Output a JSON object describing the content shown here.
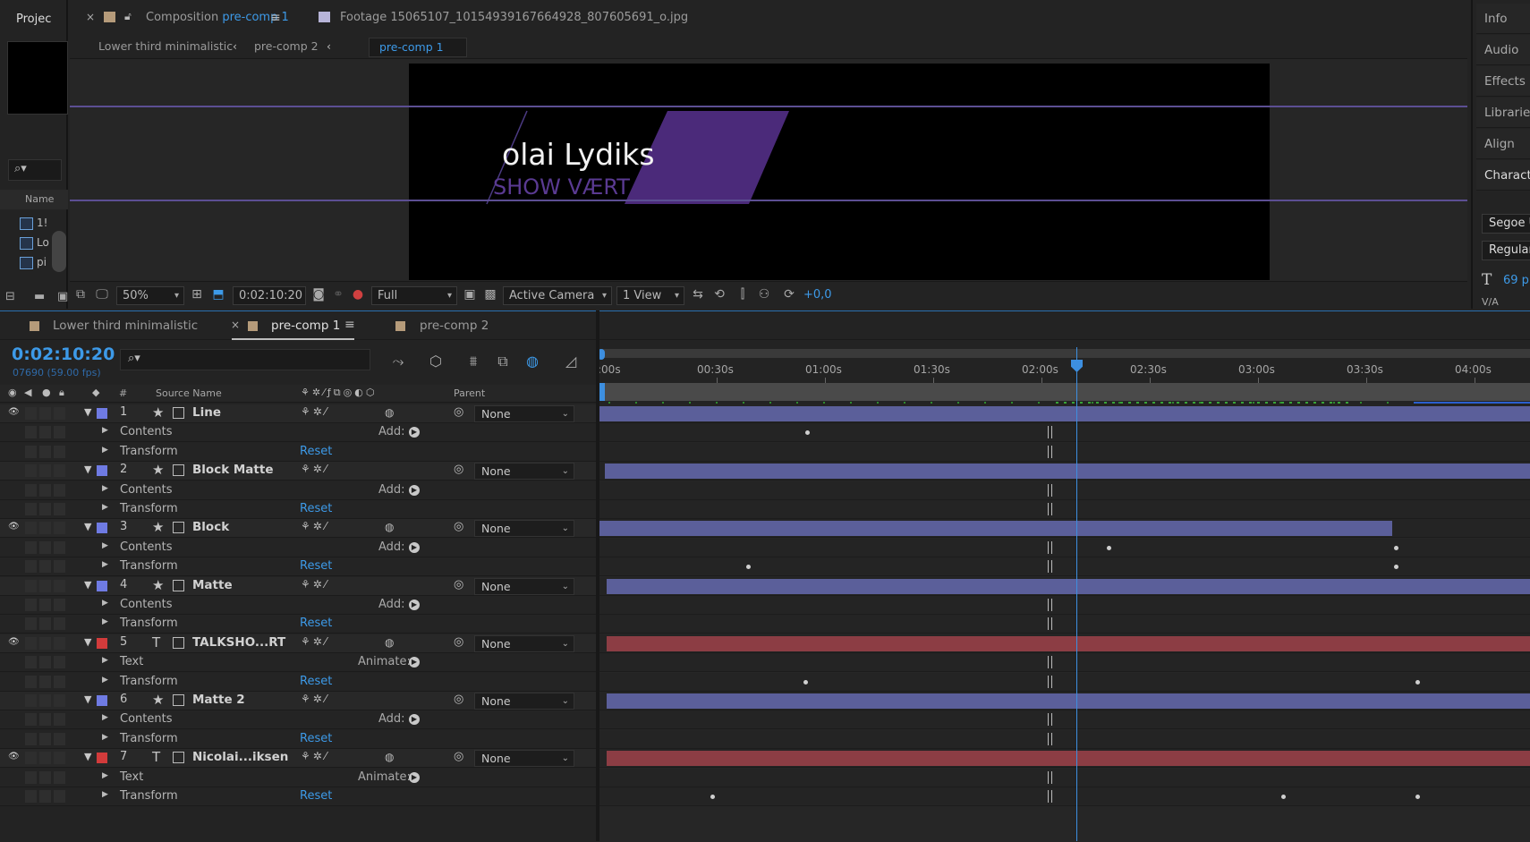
{
  "project": {
    "tab_label": "Projec",
    "name_header": "Name",
    "items": [
      "1!",
      "Lo",
      "pi"
    ]
  },
  "composition": {
    "tab_label": "Composition",
    "comp_name": "pre-comp 1",
    "footage_label": "Footage",
    "footage_name": "15065107_10154939167664928_807605691_o.jpg",
    "breadcrumbs": [
      "Lower third minimalistic",
      "pre-comp 2",
      "pre-comp 1"
    ],
    "stage": {
      "title_text": "olai Lydiks",
      "subtitle_text": "SHOW VÆRT",
      "block_color": "#4b2a7a",
      "subtitle_color": "#5a3a92"
    },
    "toolbar": {
      "zoom": "50%",
      "timecode": "0:02:10:20",
      "resolution": "Full",
      "camera": "Active Camera",
      "view": "1 View",
      "exposure": "+0,0"
    }
  },
  "right_panel": {
    "items": [
      "Info",
      "Audio",
      "Effects &",
      "Libraries",
      "Align",
      "Characte"
    ],
    "font_family": "Segoe U",
    "font_style": "Regular",
    "font_size": "69 p",
    "tracking_label": "V/A"
  },
  "timeline": {
    "tabs": [
      "Lower third minimalistic",
      "pre-comp 1",
      "pre-comp 2"
    ],
    "active_tab": "pre-comp 1",
    "timecode": "0:02:10:20",
    "frame_info": "07690 (59.00 fps)",
    "header": {
      "hash": "#",
      "source_name": "Source Name",
      "parent": "Parent"
    },
    "ruler_labels": [
      ":00s",
      "00:30s",
      "01:00s",
      "01:30s",
      "02:00s",
      "02:30s",
      "03:00s",
      "03:30s",
      "04:00s"
    ],
    "layers": [
      {
        "num": "1",
        "name": "Line",
        "type": "shape",
        "color": "#6f7be3",
        "visible": true,
        "motion_blur": true,
        "parent": "None",
        "prop1": "Contents",
        "prop1_action": "Add:",
        "prop2": "Transform",
        "bar_color": "#5b5f9a"
      },
      {
        "num": "2",
        "name": "Block Matte",
        "type": "shape",
        "color": "#6f7be3",
        "visible": false,
        "motion_blur": false,
        "parent": "None",
        "prop1": "Contents",
        "prop1_action": "Add:",
        "prop2": "Transform",
        "bar_color": "#5b5f9a"
      },
      {
        "num": "3",
        "name": "Block",
        "type": "shape",
        "color": "#6f7be3",
        "visible": true,
        "motion_blur": true,
        "parent": "None",
        "prop1": "Contents",
        "prop1_action": "Add:",
        "prop2": "Transform",
        "bar_color": "#5b5f9a"
      },
      {
        "num": "4",
        "name": "Matte",
        "type": "shape",
        "color": "#6f7be3",
        "visible": false,
        "motion_blur": false,
        "parent": "None",
        "prop1": "Contents",
        "prop1_action": "Add:",
        "prop2": "Transform",
        "bar_color": "#5b5f9a"
      },
      {
        "num": "5",
        "name": "TALKSHO...RT",
        "type": "text",
        "color": "#d23b3b",
        "visible": true,
        "motion_blur": true,
        "parent": "None",
        "prop1": "Text",
        "prop1_action": "Animate:",
        "prop2": "Transform",
        "bar_color": "#8c3d44"
      },
      {
        "num": "6",
        "name": "Matte 2",
        "type": "shape",
        "color": "#6f7be3",
        "visible": false,
        "motion_blur": false,
        "parent": "None",
        "prop1": "Contents",
        "prop1_action": "Add:",
        "prop2": "Transform",
        "bar_color": "#5b5f9a"
      },
      {
        "num": "7",
        "name": "Nicolai...iksen",
        "type": "text",
        "color": "#d23b3b",
        "visible": true,
        "motion_blur": true,
        "parent": "None",
        "prop1": "Text",
        "prop1_action": "Animate:",
        "prop2": "Transform",
        "bar_color": "#8c3d44"
      }
    ],
    "reset_label": "Reset"
  }
}
